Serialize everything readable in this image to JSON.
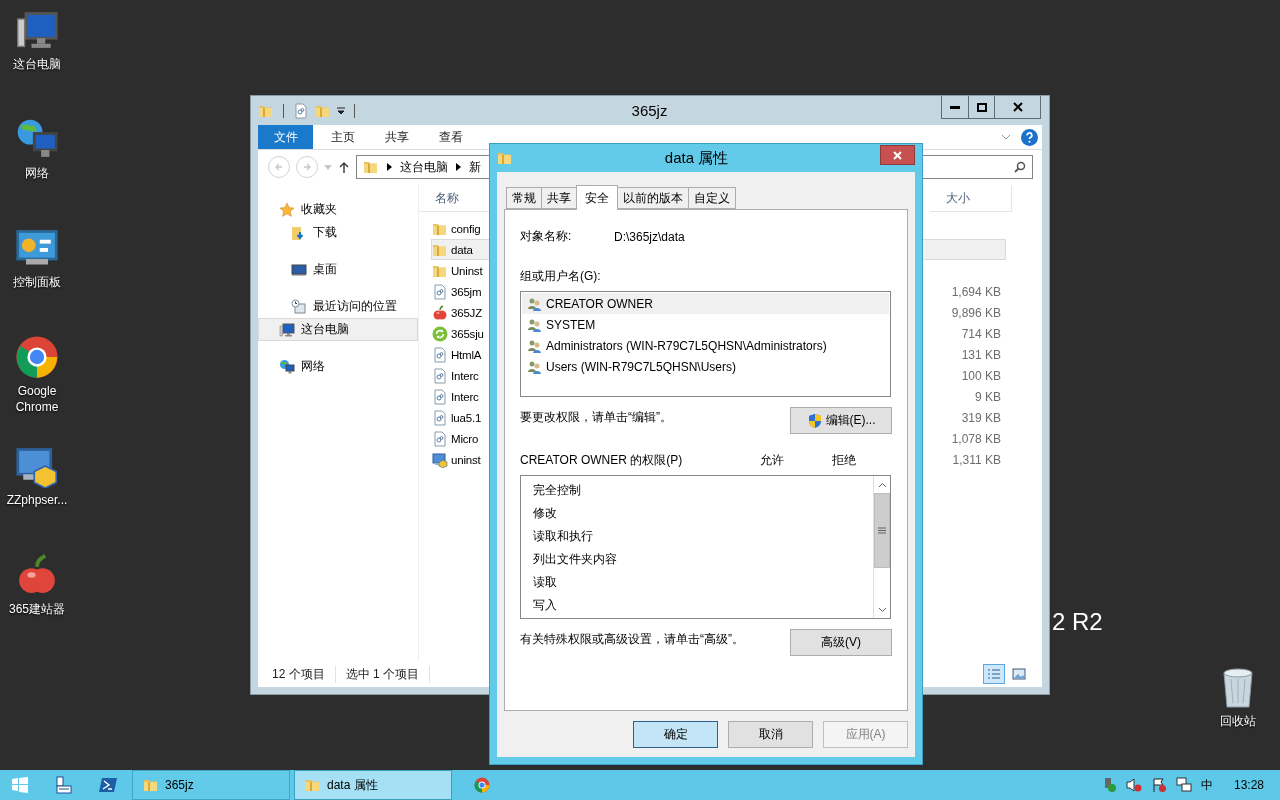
{
  "desktop": {
    "icons": [
      {
        "label": "这台电脑",
        "kind": "computer"
      },
      {
        "label": "网络",
        "kind": "globe"
      },
      {
        "label": "控制面板",
        "kind": "panel"
      },
      {
        "label": "Google Chrome",
        "kind": "chrome"
      },
      {
        "label": "ZZphpser...",
        "kind": "installer"
      },
      {
        "label": "365建站器",
        "kind": "apple"
      }
    ],
    "recycle_bin": {
      "label": "回收站"
    },
    "edition_text": "2 R2"
  },
  "explorer": {
    "title": "365jz",
    "ribbon_tabs": [
      {
        "label": "文件",
        "selected": true
      },
      {
        "label": "主页",
        "selected": false
      },
      {
        "label": "共享",
        "selected": false
      },
      {
        "label": "查看",
        "selected": false
      }
    ],
    "address": [
      "这台电脑",
      "新"
    ],
    "nav": [
      {
        "label": "收藏夹",
        "kind": "star",
        "selected": false,
        "children": [
          {
            "label": "下载",
            "kind": "download",
            "selected": false
          },
          {
            "label": "桌面",
            "kind": "desktop",
            "selected": false
          },
          {
            "label": "最近访问的位置",
            "kind": "recent",
            "selected": false
          }
        ]
      },
      {
        "label": "这台电脑",
        "kind": "computer",
        "selected": true
      },
      {
        "label": "网络",
        "kind": "globe",
        "selected": false
      }
    ],
    "columns": [
      "名称",
      "大小"
    ],
    "files": [
      {
        "name": "config",
        "kind": "folder",
        "selected": false
      },
      {
        "name": "data",
        "kind": "folder",
        "selected": true
      },
      {
        "name": "Uninst",
        "kind": "folder",
        "selected": false
      },
      {
        "name": "365jm",
        "kind": "dll",
        "size": "1,694 KB",
        "selected": false
      },
      {
        "name": "365JZ",
        "kind": "apple",
        "size": "9,896 KB",
        "selected": false
      },
      {
        "name": "365sju",
        "kind": "refresh",
        "size": "714 KB",
        "selected": false
      },
      {
        "name": "HtmlA",
        "kind": "dll",
        "size": "131 KB",
        "selected": false
      },
      {
        "name": "Interc",
        "kind": "dll",
        "size": "100 KB",
        "selected": false
      },
      {
        "name": "Interc",
        "kind": "dll",
        "size": "9 KB",
        "selected": false
      },
      {
        "name": "lua5.1",
        "kind": "dll",
        "size": "319 KB",
        "selected": false
      },
      {
        "name": "Micro",
        "kind": "dll",
        "size": "1,078 KB",
        "selected": false
      },
      {
        "name": "uninst",
        "kind": "installer",
        "size": "1,311 KB",
        "selected": false
      }
    ],
    "status": [
      "12 个项目",
      "选中 1 个项目"
    ]
  },
  "dialog": {
    "title": "data 属性",
    "tabs": [
      {
        "label": "常规",
        "selected": false
      },
      {
        "label": "共享",
        "selected": false
      },
      {
        "label": "安全",
        "selected": true
      },
      {
        "label": "以前的版本",
        "selected": false
      },
      {
        "label": "自定义",
        "selected": false
      }
    ],
    "object_label": "对象名称:",
    "object_value": "D:\\365jz\\data",
    "users_label": "组或用户名(G):",
    "users": [
      {
        "name": "CREATOR OWNER",
        "selected": true
      },
      {
        "name": "SYSTEM",
        "selected": false
      },
      {
        "name": "Administrators (WIN-R79C7L5QHSN\\Administrators)",
        "selected": false
      },
      {
        "name": "Users (WIN-R79C7L5QHSN\\Users)",
        "selected": false
      }
    ],
    "edit_hint": "要更改权限，请单击“编辑”。",
    "edit_button": "编辑(E)...",
    "permissions_label": "CREATOR OWNER 的权限(P)",
    "allow_label": "允许",
    "deny_label": "拒绝",
    "permissions": [
      "完全控制",
      "修改",
      "读取和执行",
      "列出文件夹内容",
      "读取",
      "写入"
    ],
    "advanced_hint": "有关特殊权限或高级设置，请单击“高级”。",
    "advanced_button": "高级(V)",
    "buttons": [
      {
        "label": "确定",
        "focused": true,
        "disabled": false
      },
      {
        "label": "取消",
        "focused": false,
        "disabled": false
      },
      {
        "label": "应用(A)",
        "focused": false,
        "disabled": true
      }
    ]
  },
  "taskbar": {
    "tasks": [
      {
        "label": "365jz",
        "active": false
      },
      {
        "label": "data 属性",
        "active": true
      }
    ],
    "ime": "中",
    "clock": "13:28"
  }
}
